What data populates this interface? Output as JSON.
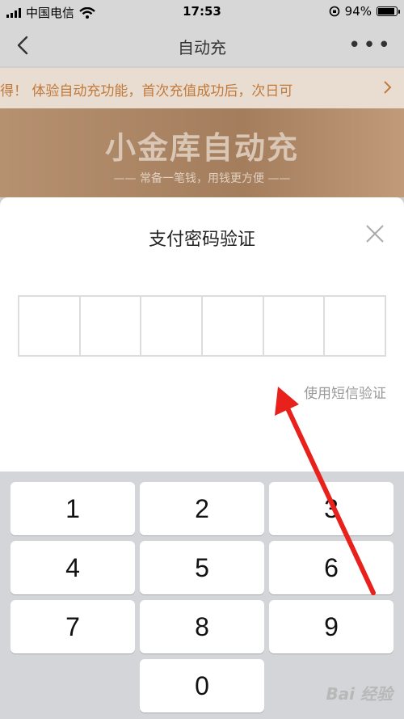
{
  "status_bar": {
    "carrier": "中国电信",
    "time": "17:53",
    "battery": "94%"
  },
  "nav": {
    "title": "自动充"
  },
  "notice": {
    "text": "得！    体验自动充功能，首次充值成功后，次日可"
  },
  "banner": {
    "headline": "小金库自动充",
    "subtitle": "—— 常备一笔钱，用钱更方便 ——"
  },
  "dialog": {
    "title": "支付密码验证",
    "alt_link": "使用短信验证",
    "pin_length": 6
  },
  "keypad": {
    "keys": [
      "1",
      "2",
      "3",
      "4",
      "5",
      "6",
      "7",
      "8",
      "9",
      "0"
    ]
  },
  "watermark": {
    "text": "Bai 经验"
  },
  "colors": {
    "accent": "#c07a3b",
    "arrow": "#e8211c"
  }
}
